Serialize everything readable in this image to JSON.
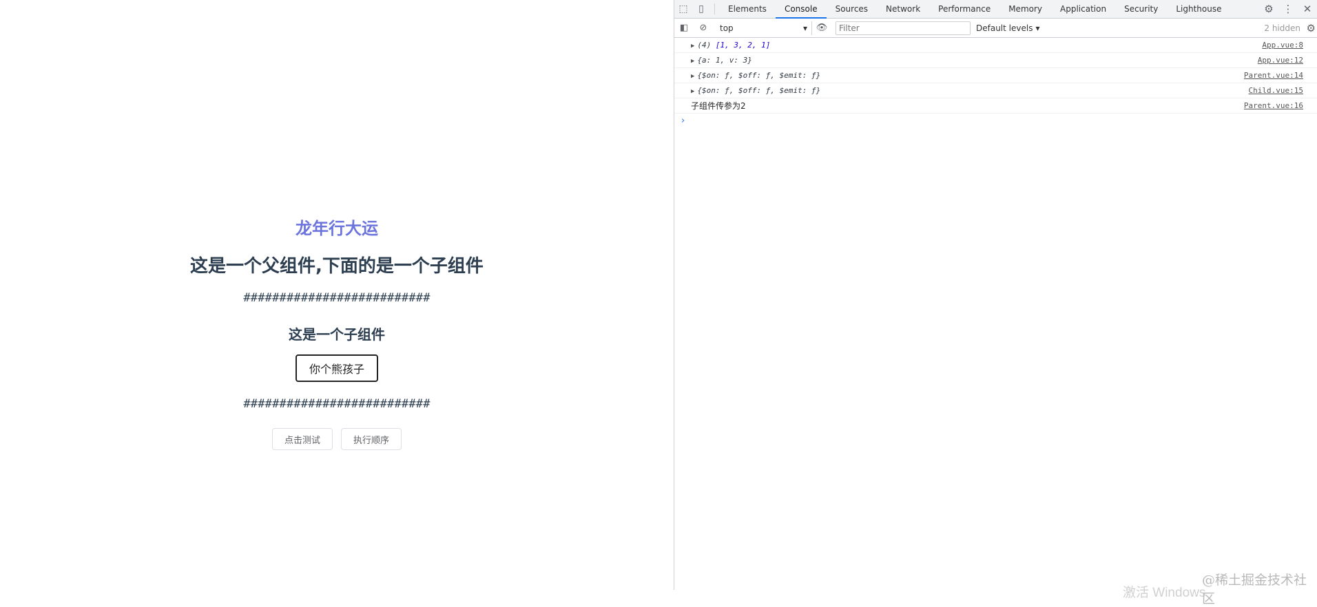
{
  "page": {
    "hero_title": "龙年行大运",
    "parent_heading": "这是一个父组件,下面的是一个子组件",
    "divider_top": "##########################",
    "child_heading": "这是一个子组件",
    "child_button": "你个熊孩子",
    "divider_bottom": "##########################",
    "btn_click_test": "点击测试",
    "btn_exec_order": "执行顺序"
  },
  "devtools": {
    "tabs": [
      "Elements",
      "Console",
      "Sources",
      "Network",
      "Performance",
      "Memory",
      "Application",
      "Security",
      "Lighthouse"
    ],
    "active_tab": "Console",
    "context": "top",
    "filter_placeholder": "Filter",
    "levels": "Default levels",
    "hidden": "2 hidden",
    "logs": [
      {
        "prefix": "(4) ",
        "text": "[1, 3, 2, 1]",
        "source": "App.vue:8"
      },
      {
        "prefix": "",
        "text": "{a: 1, v: 3}",
        "source": "App.vue:12"
      },
      {
        "prefix": "",
        "text": "{$on: ƒ, $off: ƒ, $emit: ƒ}",
        "source": "Parent.vue:14"
      },
      {
        "prefix": "",
        "text": "{$on: ƒ, $off: ƒ, $emit: ƒ}",
        "source": "Child.vue:15"
      },
      {
        "prefix": "",
        "text": "子组件传参为2",
        "source": "Parent.vue:16"
      }
    ]
  },
  "overlay": {
    "watermark": "@稀土掘金技术社区",
    "activation": "激活 Windows"
  },
  "colors": {
    "hero": "#6b73dd",
    "heading": "#2c3e50",
    "accent": "#1a73e8"
  }
}
